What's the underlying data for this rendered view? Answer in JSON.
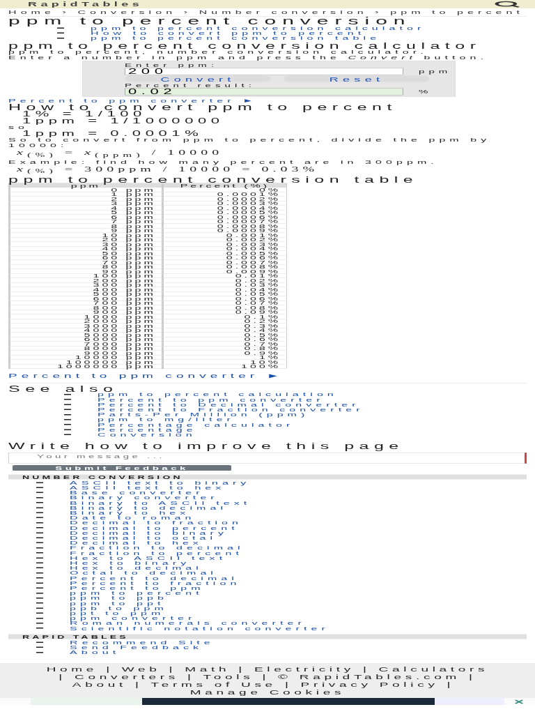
{
  "header": {
    "logo": "RapidTables"
  },
  "breadcrumb": "Home › Conversion › Number conversion › ppm to percent",
  "title": "ppm to percent conversion",
  "toc": [
    "ppm to percent conversion calculator",
    "How to convert ppm to percent",
    "ppm to percent conversion table"
  ],
  "calculator_section": {
    "heading": "ppm to percent conversion calculator",
    "intro": [
      "ppm to percent, number conversion calculator.",
      "Enter a number in ppm and press the *Convert* button."
    ]
  },
  "calculator": {
    "input_label": "Enter ppm:",
    "input_value": "200",
    "input_unit": "ppm",
    "buttons": [
      "Convert",
      "Reset"
    ],
    "result_label": "Percent result:",
    "result_value": "0.02",
    "result_unit": "%"
  },
  "converter_link_top": "Percent to ppm converter ►",
  "how_to": {
    "heading": "How to convert ppm to percent",
    "lines": [
      {
        "kind": "math",
        "text": "1% = 1/100"
      },
      {
        "kind": "math",
        "text": "1ppm = 1/1000000"
      },
      {
        "kind": "text",
        "text": "so"
      },
      {
        "kind": "math",
        "text": "1ppm = 0.0001%"
      },
      {
        "kind": "text",
        "text": "So to convert from ppm to percent, divide the ppm by 10000:"
      },
      {
        "kind": "formula",
        "text": "*x*$_{(%)}$ = *x*$_{(ppm)}$ / 10000"
      },
      {
        "kind": "text",
        "text": "Example: find how many percent are in 300ppm."
      },
      {
        "kind": "formula",
        "text": "*x*$_{(%)}$ = 300ppm / 10000 = 0.03%"
      }
    ]
  },
  "table": {
    "heading": "ppm to percent conversion table",
    "columns": [
      "ppm",
      "Percent (%)"
    ],
    "rows": [
      [
        "0 ppm",
        "0%"
      ],
      [
        "1 ppm",
        "0.0001%"
      ],
      [
        "2 ppm",
        "0.0002%"
      ],
      [
        "3 ppm",
        "0.0003%"
      ],
      [
        "4 ppm",
        "0.0004%"
      ],
      [
        "5 ppm",
        "0.0005%"
      ],
      [
        "6 ppm",
        "0.0006%"
      ],
      [
        "7 ppm",
        "0.0007%"
      ],
      [
        "8 ppm",
        "0.0008%"
      ],
      [
        "9 ppm",
        "0.0009%"
      ],
      [
        "10 ppm",
        "0.001%"
      ],
      [
        "20 ppm",
        "0.002%"
      ],
      [
        "30 ppm",
        "0.003%"
      ],
      [
        "40 ppm",
        "0.004%"
      ],
      [
        "50 ppm",
        "0.005%"
      ],
      [
        "60 ppm",
        "0.006%"
      ],
      [
        "70 ppm",
        "0.007%"
      ],
      [
        "80 ppm",
        "0.008%"
      ],
      [
        "90 ppm",
        "0.009%"
      ],
      [
        "100 ppm",
        "0.01%"
      ],
      [
        "200 ppm",
        "0.02%"
      ],
      [
        "300 ppm",
        "0.03%"
      ],
      [
        "400 ppm",
        "0.04%"
      ],
      [
        "500 ppm",
        "0.05%"
      ],
      [
        "600 ppm",
        "0.06%"
      ],
      [
        "700 ppm",
        "0.07%"
      ],
      [
        "800 ppm",
        "0.08%"
      ],
      [
        "900 ppm",
        "0.09%"
      ],
      [
        "1000 ppm",
        "0.1%"
      ],
      [
        "2000 ppm",
        "0.2%"
      ],
      [
        "3000 ppm",
        "0.3%"
      ],
      [
        "4000 ppm",
        "0.4%"
      ],
      [
        "5000 ppm",
        "0.5%"
      ],
      [
        "6000 ppm",
        "0.6%"
      ],
      [
        "7000 ppm",
        "0.7%"
      ],
      [
        "8000 ppm",
        "0.8%"
      ],
      [
        "9000 ppm",
        "0.9%"
      ],
      [
        "10000 ppm",
        "1%"
      ],
      [
        "100000 ppm",
        "10%"
      ],
      [
        "1000000 ppm",
        "100%"
      ]
    ]
  },
  "converter_link_bottom": "Percent to ppm converter ►",
  "see_also": {
    "heading": "See also",
    "links": [
      "ppm to percent calculation",
      "Percent to ppm converter",
      "Percent to Decimal converter",
      "Percent to Fraction converter",
      "Parts-Per Million (ppm)",
      "ppm to mg/liter",
      "Percentage calculator",
      "Percentage",
      "Conversion"
    ]
  },
  "feedback": {
    "heading": "Write how to improve this page",
    "placeholder": "Your message ...",
    "button": "Submit Feedback"
  },
  "nav_sections": [
    {
      "title": "NUMBER CONVERSION",
      "links": [
        "ASCII text to binary",
        "ASCII text to hex",
        "Base converter",
        "Binary converter",
        "Binary to ASCII text",
        "Binary to decimal",
        "Binary to hex",
        "Date to roman",
        "Decimal to fraction",
        "Decimal to percent",
        "Decimal to binary",
        "Decimal to octal",
        "Decimal to hex",
        "Fraction to decimal",
        "Fraction to percent",
        "Hex to ASCII text",
        "Hex to binary",
        "Hex to decimal",
        "Octal to decimal",
        "Percent to decimal",
        "Percent to fraction",
        "Percent to ppm",
        "ppm to percent",
        "ppm to ppb",
        "ppm to ppt",
        "ppb to ppm",
        "ppt to ppm",
        "ppm converter",
        "Roman numerals converter",
        "Scientific notation converter"
      ]
    },
    {
      "title": "RAPID TABLES",
      "links": [
        "Recommend Site",
        "Send Feedback",
        "About"
      ]
    }
  ],
  "footer": {
    "separator": "|",
    "links": [
      "Home",
      "Web",
      "Math",
      "Electricity",
      "Calculators",
      "Converters",
      "Tools",
      "© RapidTables.com",
      "About",
      "Terms of Use",
      "Privacy Policy",
      "Manage Cookies"
    ]
  }
}
